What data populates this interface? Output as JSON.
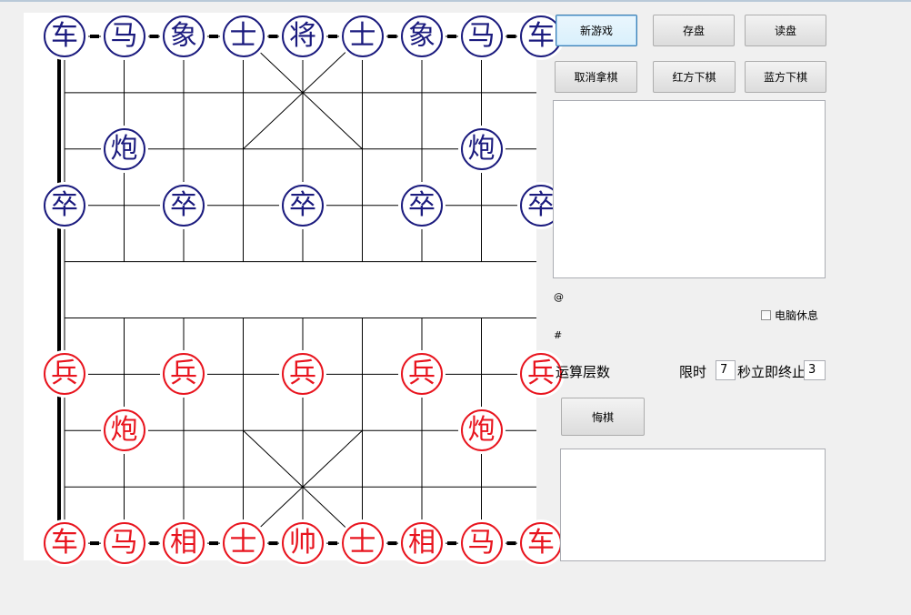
{
  "colors": {
    "red_side": "#e8141e",
    "blue_side": "#1b1b7e"
  },
  "board": {
    "blue_pieces": [
      {
        "name": "车",
        "file": 0,
        "rank": 0
      },
      {
        "name": "马",
        "file": 1,
        "rank": 0
      },
      {
        "name": "象",
        "file": 2,
        "rank": 0
      },
      {
        "name": "士",
        "file": 3,
        "rank": 0
      },
      {
        "name": "将",
        "file": 4,
        "rank": 0
      },
      {
        "name": "士",
        "file": 5,
        "rank": 0
      },
      {
        "name": "象",
        "file": 6,
        "rank": 0
      },
      {
        "name": "马",
        "file": 7,
        "rank": 0
      },
      {
        "name": "车",
        "file": 8,
        "rank": 0
      },
      {
        "name": "炮",
        "file": 1,
        "rank": 2
      },
      {
        "name": "炮",
        "file": 7,
        "rank": 2
      },
      {
        "name": "卒",
        "file": 0,
        "rank": 3
      },
      {
        "name": "卒",
        "file": 2,
        "rank": 3
      },
      {
        "name": "卒",
        "file": 4,
        "rank": 3
      },
      {
        "name": "卒",
        "file": 6,
        "rank": 3
      },
      {
        "name": "卒",
        "file": 8,
        "rank": 3
      }
    ],
    "red_pieces": [
      {
        "name": "兵",
        "file": 0,
        "rank": 6
      },
      {
        "name": "兵",
        "file": 2,
        "rank": 6
      },
      {
        "name": "兵",
        "file": 4,
        "rank": 6
      },
      {
        "name": "兵",
        "file": 6,
        "rank": 6
      },
      {
        "name": "兵",
        "file": 8,
        "rank": 6
      },
      {
        "name": "炮",
        "file": 1,
        "rank": 7
      },
      {
        "name": "炮",
        "file": 7,
        "rank": 7
      },
      {
        "name": "车",
        "file": 0,
        "rank": 9
      },
      {
        "name": "马",
        "file": 1,
        "rank": 9
      },
      {
        "name": "相",
        "file": 2,
        "rank": 9
      },
      {
        "name": "士",
        "file": 3,
        "rank": 9
      },
      {
        "name": "帅",
        "file": 4,
        "rank": 9
      },
      {
        "name": "士",
        "file": 5,
        "rank": 9
      },
      {
        "name": "相",
        "file": 6,
        "rank": 9
      },
      {
        "name": "马",
        "file": 7,
        "rank": 9
      },
      {
        "name": "车",
        "file": 8,
        "rank": 9
      }
    ]
  },
  "controls": {
    "new_game": "新游戏",
    "save_game": "存盘",
    "load_game": "读盘",
    "cancel_pick": "取消拿棋",
    "red_move": "红方下棋",
    "blue_move": "蓝方下棋",
    "at_label": "@",
    "hash_label": "#",
    "computer_rest": "电脑休息",
    "search_depth_label": "运算层数",
    "time_limit_label": "限时",
    "time_limit_value": "7",
    "stop_label": "秒立即终止",
    "stop_value": "3",
    "undo": "悔棋"
  }
}
